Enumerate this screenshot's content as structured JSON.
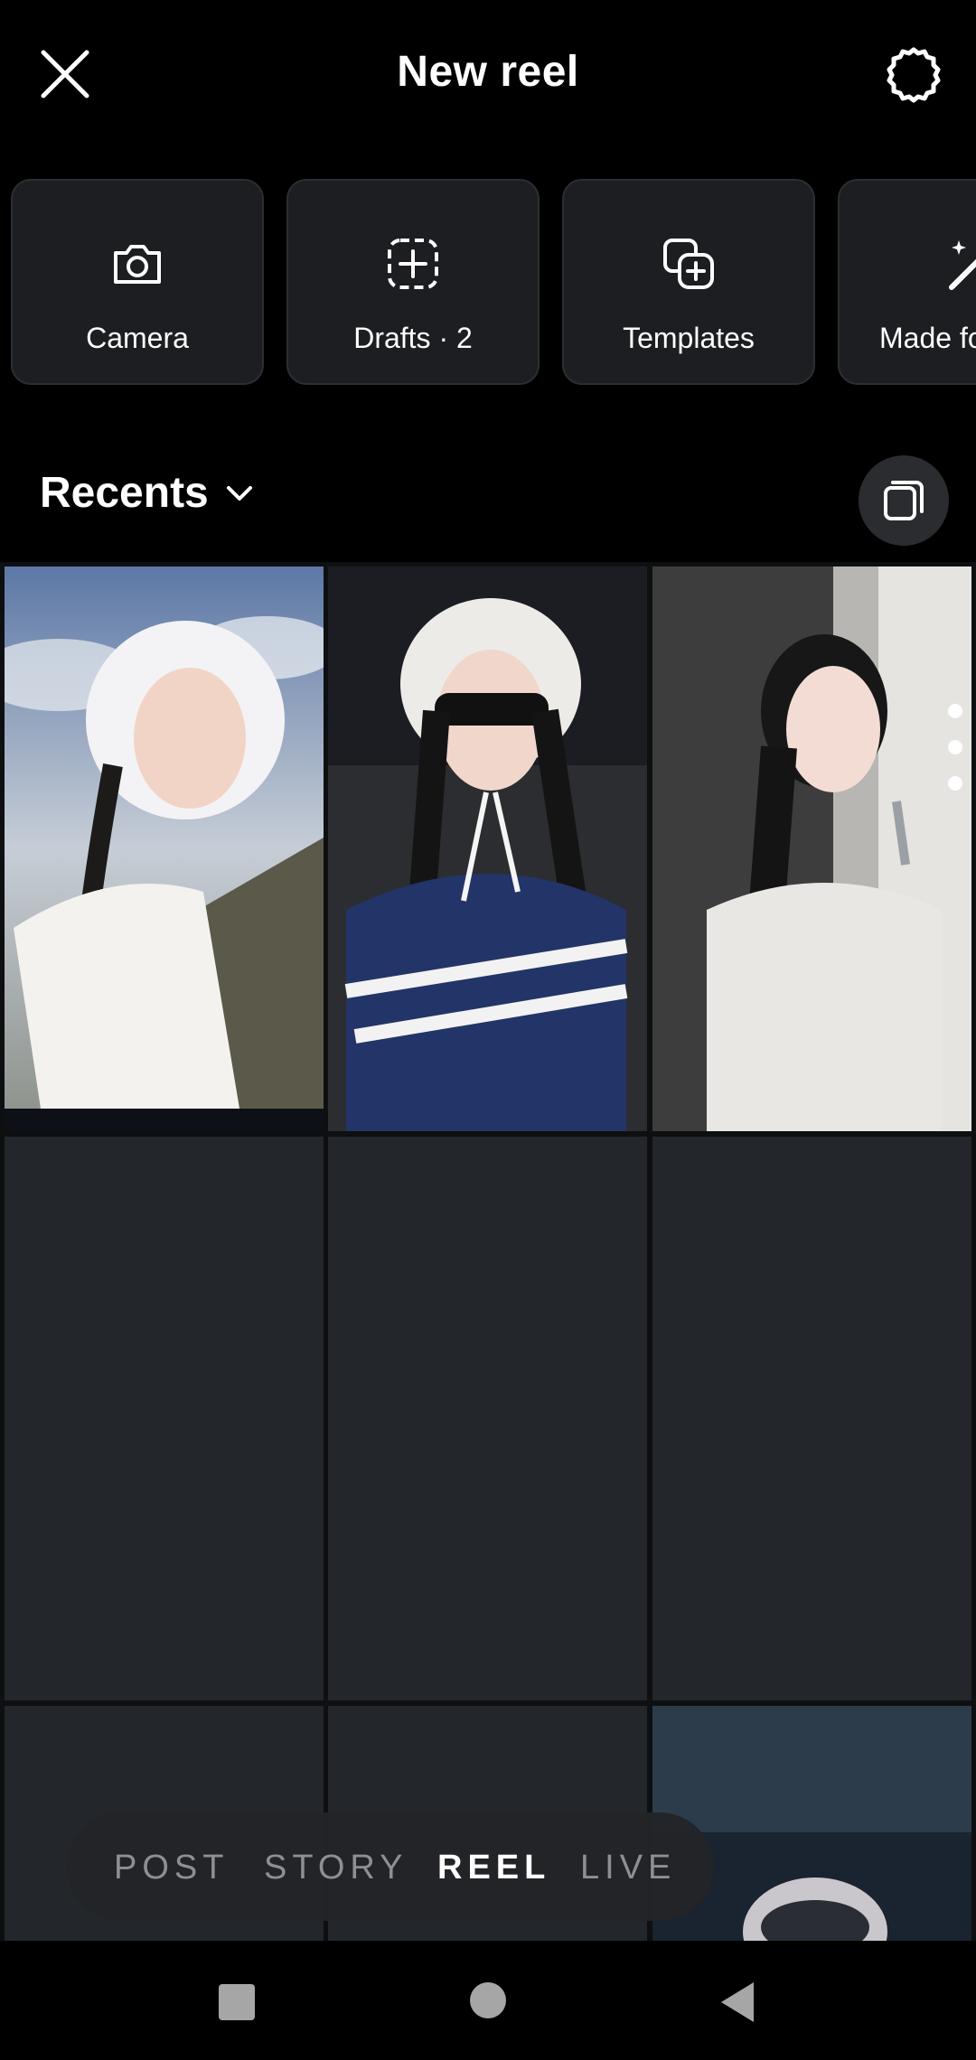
{
  "header": {
    "title": "New reel"
  },
  "cards": [
    {
      "label": "Camera",
      "icon": "camera-icon"
    },
    {
      "label": "Drafts · 2",
      "icon": "drafts-add-icon"
    },
    {
      "label": "Templates",
      "icon": "templates-icon"
    },
    {
      "label": "Made fo",
      "icon": "magic-wand-icon"
    }
  ],
  "gallery": {
    "album_label": "Recents"
  },
  "modes": {
    "post": "POST",
    "story": "STORY",
    "reel": "REEL",
    "live": "LIVE",
    "selected": "REEL"
  },
  "colors": {
    "background": "#000000",
    "card": "#1c1e22",
    "placeholder": "#23262b"
  }
}
